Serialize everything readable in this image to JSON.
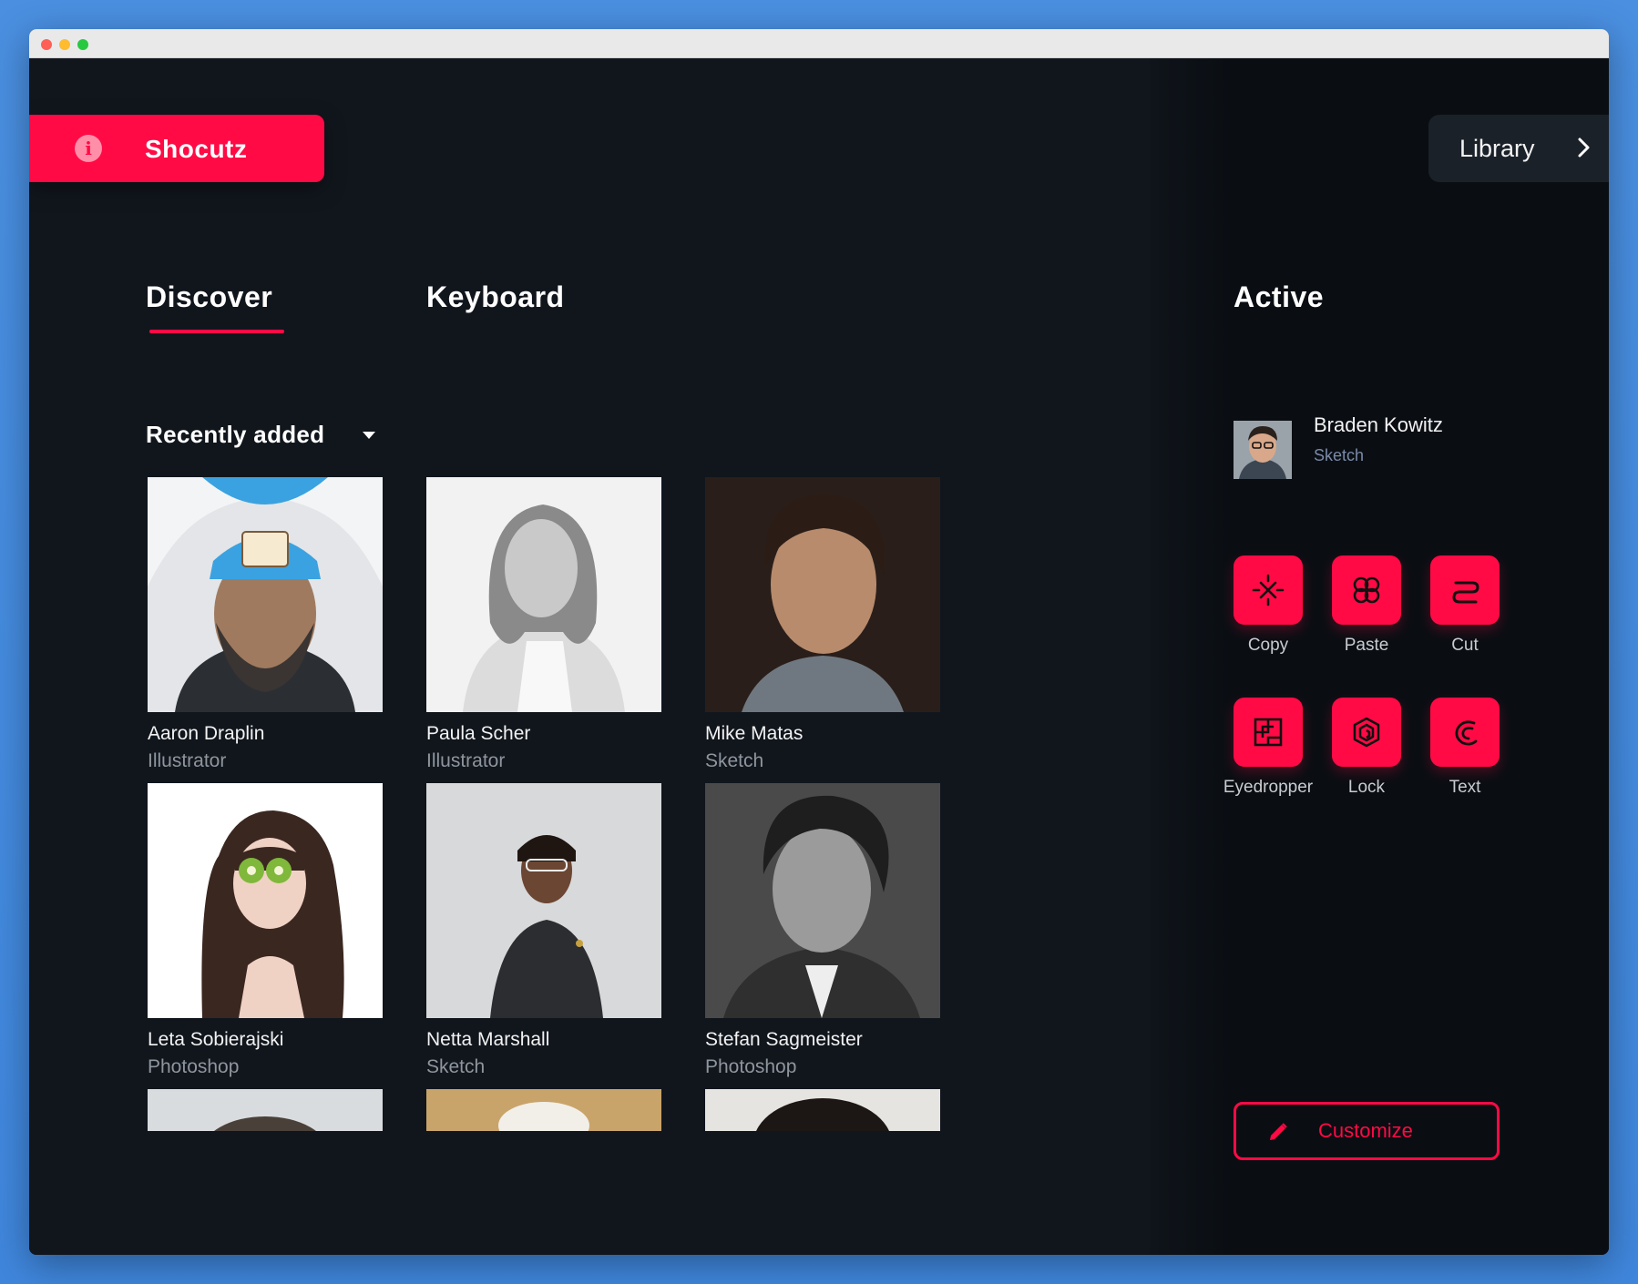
{
  "brand": {
    "name": "Shocutz",
    "info_icon": "info-icon",
    "color": "#ff0a45"
  },
  "library": {
    "label": "Library",
    "icon": "chevron-right-icon"
  },
  "tabs": [
    {
      "label": "Discover",
      "active": true
    },
    {
      "label": "Keyboard",
      "active": false
    }
  ],
  "filter": {
    "label": "Recently added",
    "icon": "caret-down-icon"
  },
  "people": [
    {
      "name": "Aaron Draplin",
      "role": "Illustrator"
    },
    {
      "name": "Paula Scher",
      "role": "Illustrator"
    },
    {
      "name": "Mike Matas",
      "role": "Sketch"
    },
    {
      "name": "Leta Sobierajski",
      "role": "Photoshop"
    },
    {
      "name": "Netta Marshall",
      "role": "Sketch"
    },
    {
      "name": "Stefan Sagmeister",
      "role": "Photoshop"
    }
  ],
  "active": {
    "title": "Active",
    "user": {
      "name": "Braden Kowitz",
      "tool": "Sketch"
    },
    "actions": [
      {
        "label": "Copy",
        "icon": "copy-icon"
      },
      {
        "label": "Paste",
        "icon": "paste-icon"
      },
      {
        "label": "Cut",
        "icon": "cut-icon"
      },
      {
        "label": "Eyedropper",
        "icon": "eyedropper-icon"
      },
      {
        "label": "Lock",
        "icon": "lock-icon"
      },
      {
        "label": "Text",
        "icon": "text-icon"
      }
    ],
    "customize_label": "Customize"
  },
  "colors": {
    "accent": "#ff0a45",
    "background": "#11161d",
    "panel": "#0a0e13"
  }
}
